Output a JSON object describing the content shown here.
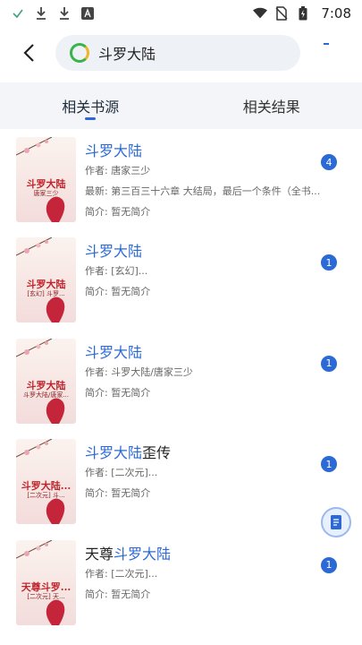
{
  "status_bar": {
    "time": "7:08",
    "left_icons": [
      "check-icon",
      "download-icon",
      "download-icon",
      "font-icon"
    ],
    "right_icons": [
      "wifi-icon",
      "no-sim-icon",
      "battery-icon"
    ]
  },
  "search": {
    "query": "斗罗大陆"
  },
  "tabs": [
    {
      "label": "相关书源",
      "active": true
    },
    {
      "label": "相关结果",
      "active": false
    }
  ],
  "accent_color": "#2b6ad6",
  "results": [
    {
      "prefix": "",
      "highlight": "斗罗大陆",
      "suffix": "",
      "author": "作者: 唐家三少",
      "latest": "最新: 第三百三十六章 大结局，最后一个条件（全书...",
      "intro": "简介: 暂无简介",
      "count": "4",
      "cover_title": "斗罗大陆",
      "cover_sub": "唐家三少"
    },
    {
      "prefix": "",
      "highlight": "斗罗大陆",
      "suffix": "",
      "author": "作者: [玄幻]...",
      "latest": "",
      "intro": "简介: 暂无简介",
      "count": "1",
      "cover_title": "斗罗大陆",
      "cover_sub": "[玄幻] 斗罗..."
    },
    {
      "prefix": "",
      "highlight": "斗罗大陆",
      "suffix": "",
      "author": "作者: 斗罗大陆/唐家三少",
      "latest": "",
      "intro": "简介: 暂无简介",
      "count": "1",
      "cover_title": "斗罗大陆",
      "cover_sub": "斗罗大陆/唐家..."
    },
    {
      "prefix": "",
      "highlight": "斗罗大陆",
      "suffix": "歪传",
      "author": "作者: [二次元]...",
      "latest": "",
      "intro": "简介: 暂无简介",
      "count": "1",
      "cover_title": "斗罗大陆...",
      "cover_sub": "[二次元] 斗..."
    },
    {
      "prefix": "天尊",
      "highlight": "斗罗大陆",
      "suffix": "",
      "author": "作者: [二次元]...",
      "latest": "",
      "intro": "简介: 暂无简介",
      "count": "1",
      "cover_title": "天尊斗罗...",
      "cover_sub": "[二次元] 天..."
    }
  ]
}
